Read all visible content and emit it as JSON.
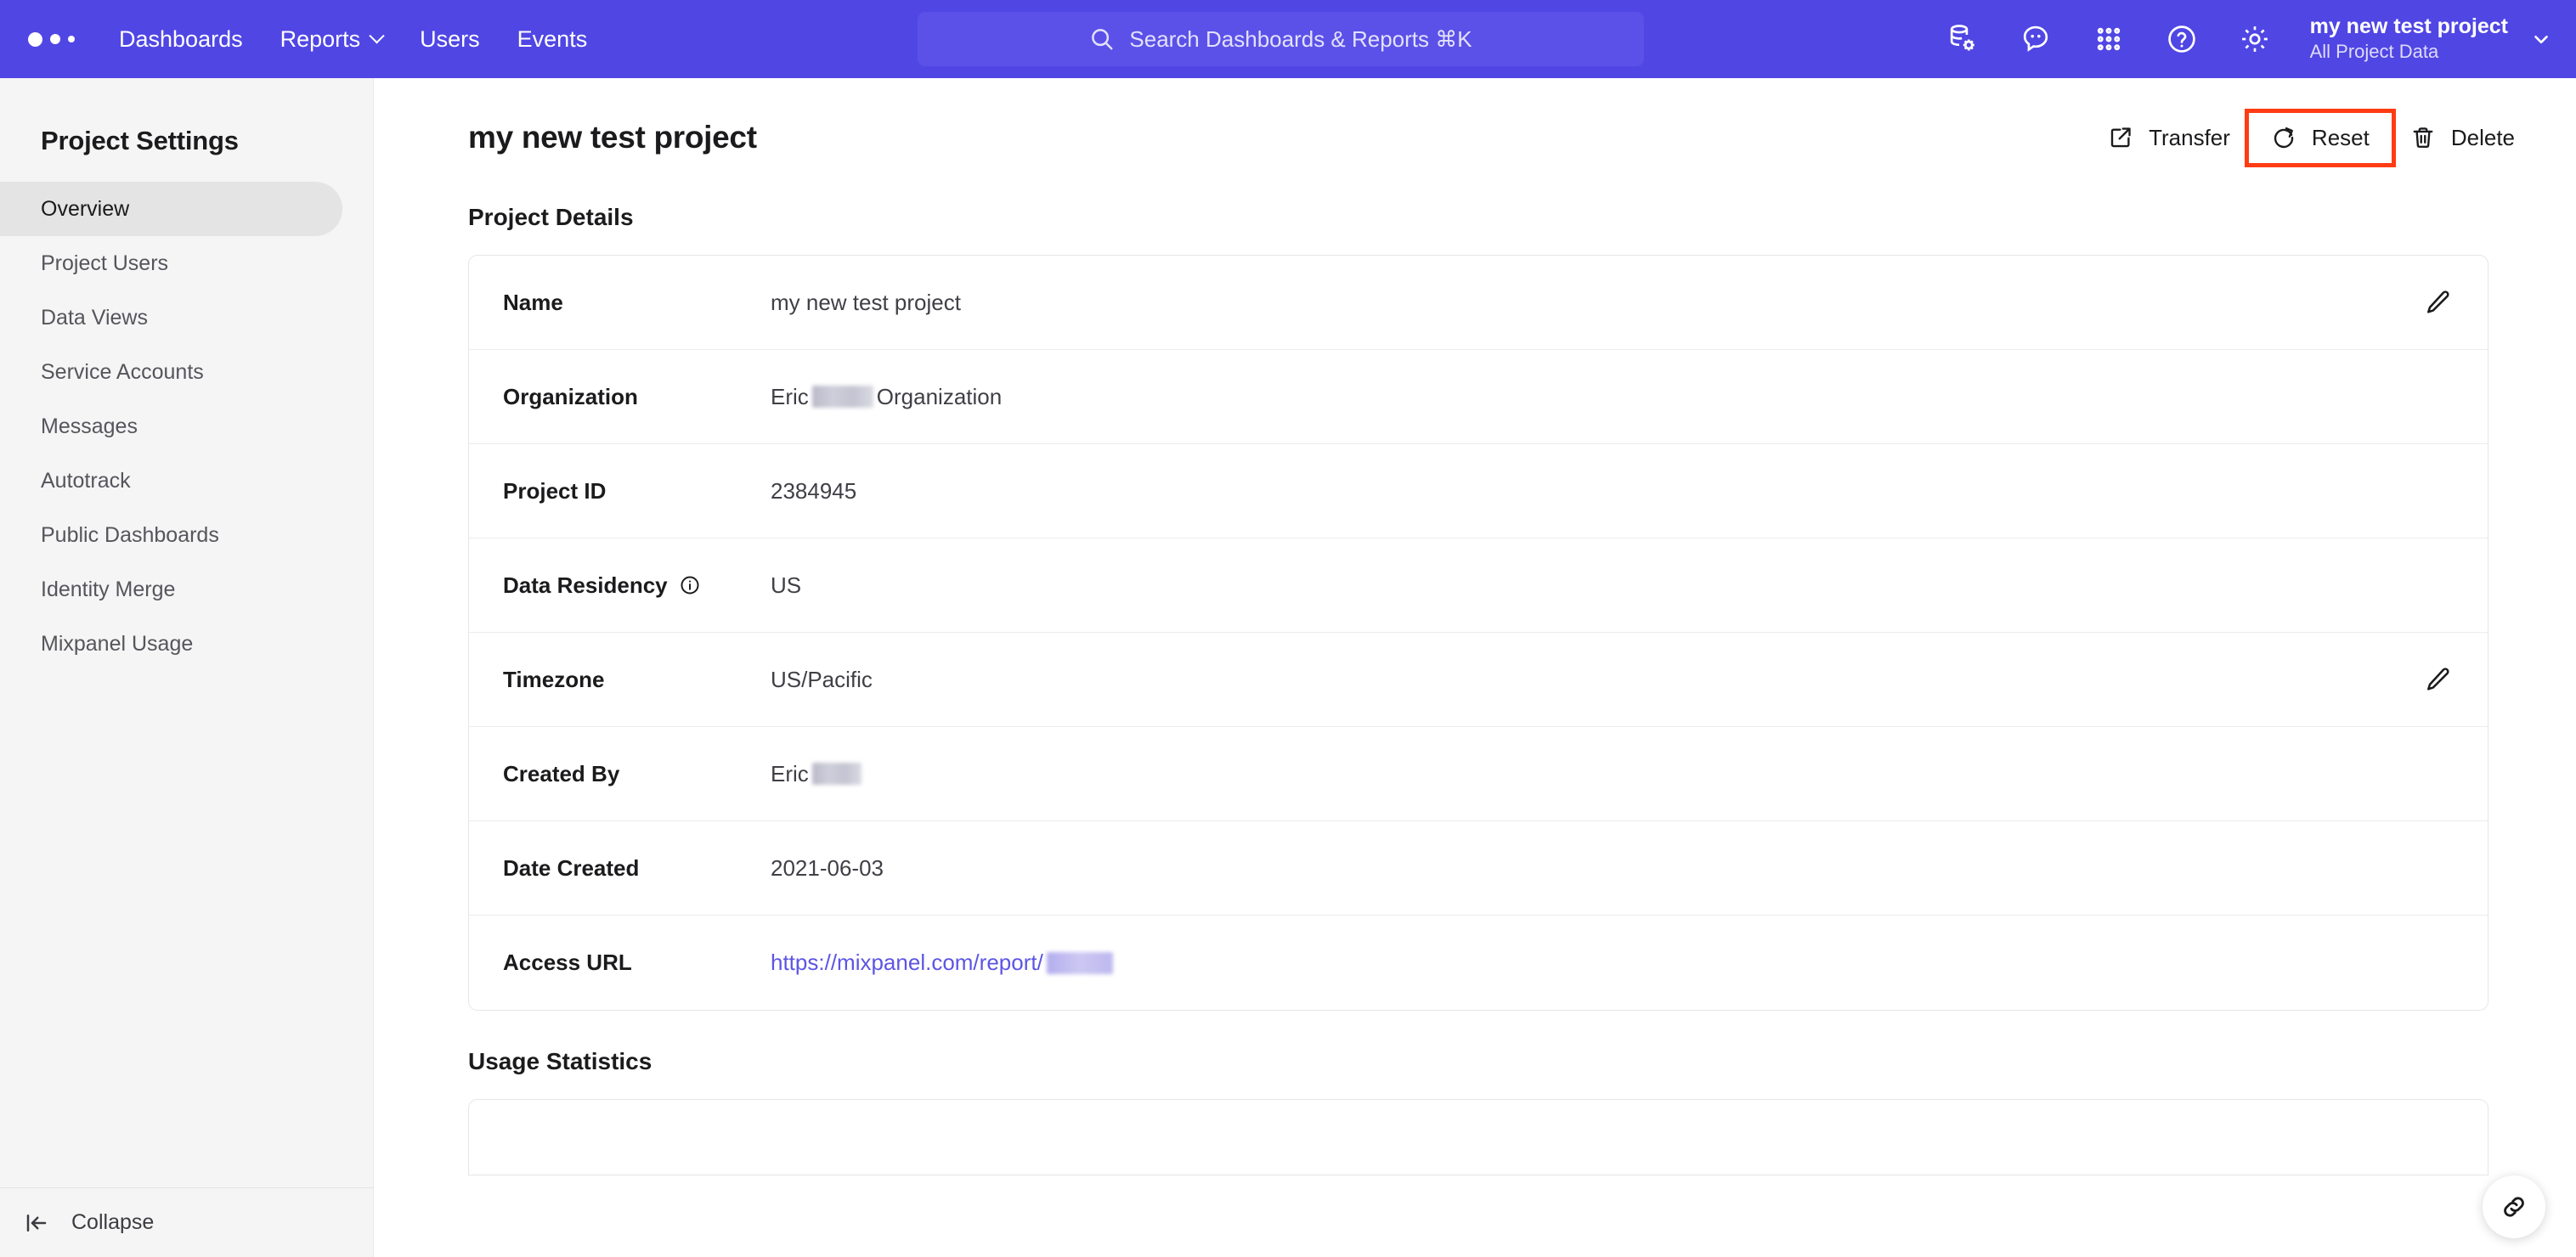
{
  "topnav": {
    "logo": "mixpanel-logo",
    "links": [
      {
        "label": "Dashboards",
        "has_chevron": false
      },
      {
        "label": "Reports",
        "has_chevron": true
      },
      {
        "label": "Users",
        "has_chevron": false
      },
      {
        "label": "Events",
        "has_chevron": false
      }
    ],
    "search": {
      "placeholder": "Search Dashboards & Reports ⌘K"
    },
    "icons": [
      "database-gear-icon",
      "feedback-bubble-icon",
      "apps-grid-icon",
      "help-circle-icon",
      "gear-icon"
    ],
    "project_switcher": {
      "project_name": "my new test project",
      "data_view": "All Project Data"
    },
    "accent_color": "#5046e4"
  },
  "sidebar": {
    "title": "Project Settings",
    "items": [
      {
        "label": "Overview",
        "active": true
      },
      {
        "label": "Project Users",
        "active": false
      },
      {
        "label": "Data Views",
        "active": false
      },
      {
        "label": "Service Accounts",
        "active": false
      },
      {
        "label": "Messages",
        "active": false
      },
      {
        "label": "Autotrack",
        "active": false
      },
      {
        "label": "Public Dashboards",
        "active": false
      },
      {
        "label": "Identity Merge",
        "active": false
      },
      {
        "label": "Mixpanel Usage",
        "active": false
      }
    ],
    "collapse_label": "Collapse"
  },
  "main": {
    "page_title": "my new test project",
    "actions": [
      {
        "label": "Transfer",
        "icon": "external-link-icon",
        "highlighted": false
      },
      {
        "label": "Reset",
        "icon": "refresh-icon",
        "highlighted": true
      },
      {
        "label": "Delete",
        "icon": "trash-icon",
        "highlighted": false
      }
    ],
    "highlight_color": "#ff3c14",
    "project_details": {
      "section_title": "Project Details",
      "rows": [
        {
          "label": "Name",
          "value": "my new test project",
          "editable": true,
          "info": false,
          "link": false,
          "redacted": false
        },
        {
          "label": "Organization",
          "value_prefix": "Eric ",
          "value_suffix": "Organization",
          "editable": false,
          "info": false,
          "link": false,
          "redacted": true
        },
        {
          "label": "Project ID",
          "value": "2384945",
          "editable": false,
          "info": false,
          "link": false,
          "redacted": false
        },
        {
          "label": "Data Residency",
          "value": "US",
          "editable": false,
          "info": true,
          "link": false,
          "redacted": false
        },
        {
          "label": "Timezone",
          "value": "US/Pacific",
          "editable": true,
          "info": false,
          "link": false,
          "redacted": false
        },
        {
          "label": "Created By",
          "value_prefix": "Eric ",
          "value_suffix": "",
          "editable": false,
          "info": false,
          "link": false,
          "redacted": true
        },
        {
          "label": "Date Created",
          "value": "2021-06-03",
          "editable": false,
          "info": false,
          "link": false,
          "redacted": false
        },
        {
          "label": "Access URL",
          "value_prefix": "https://mixpanel.com/report/",
          "value_suffix": "",
          "editable": false,
          "info": false,
          "link": true,
          "redacted": true
        }
      ]
    },
    "usage_statistics": {
      "section_title": "Usage Statistics"
    },
    "fab": {
      "icon": "link-icon"
    }
  }
}
